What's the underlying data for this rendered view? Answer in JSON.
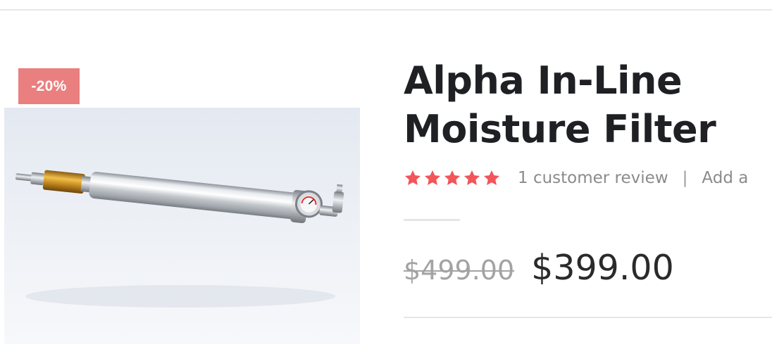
{
  "badge": {
    "label": "-20%"
  },
  "product": {
    "title": "Alpha In-Line Moisture Filter",
    "rating": {
      "stars": 5,
      "max": 5
    },
    "review_count_label": "1 customer review",
    "separator": "|",
    "add_review_label": "Add a"
  },
  "price": {
    "regular": "$499.00",
    "sale": "$399.00"
  },
  "colors": {
    "badge_bg": "#ea7f7f",
    "star": "#f2555a",
    "title": "#1f2024",
    "muted_text": "#8b8b8b"
  },
  "icons": {
    "star": "star-icon"
  }
}
